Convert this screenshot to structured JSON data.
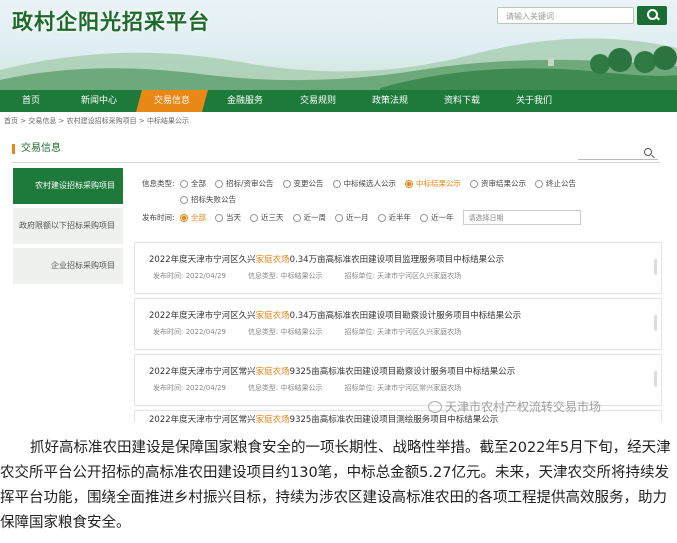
{
  "header": {
    "site_title": "政村企阳光招采平台",
    "search_placeholder": "请输入关键词"
  },
  "nav": [
    "首页",
    "新闻中心",
    "交易信息",
    "金融服务",
    "交易规则",
    "政策法规",
    "资料下载",
    "关于我们"
  ],
  "breadcrumb": "首页 > 交易信息 > 农村建设招标采购项目 > 中标结果公示",
  "panel": {
    "title": "交易信息",
    "sidebar": [
      "农村建设招标采购项目",
      "政府限额以下招标采购项目",
      "企业招标采购项目"
    ],
    "filters": {
      "info_type_label": "信息类型:",
      "info_types": [
        "全部",
        "招标/资审公告",
        "变更公告",
        "中标候选人公示",
        "中标结果公示",
        "资审结果公示",
        "终止公告",
        "招标失败公告"
      ],
      "time_label": "发布时间:",
      "times": [
        "全部",
        "当天",
        "近三天",
        "近一周",
        "近一月",
        "近半年",
        "近一年"
      ],
      "date_placeholder": "请选择日期"
    },
    "items": [
      {
        "title_pre": "2022年度天津市宁河区久兴",
        "title_hl": "家庭农场",
        "title_post": "0.34万亩高标准农田建设项目监理服务项目中标结果公示",
        "date": "发布时间:  2022/04/29",
        "type": "信息类型:  中标结果公示",
        "unit": "招标单位:  天津市宁河区久兴家庭农场"
      },
      {
        "title_pre": "2022年度天津市宁河区久兴",
        "title_hl": "家庭农场",
        "title_post": "0.34万亩高标准农田建设项目勘察设计服务项目中标结果公示",
        "date": "发布时间:  2022/04/29",
        "type": "信息类型:  中标结果公示",
        "unit": "招标单位:  天津市宁河区久兴家庭农场"
      },
      {
        "title_pre": "2022年度天津市宁河区常兴",
        "title_hl": "家庭农场",
        "title_post": "9325亩高标准农田建设项目勘察设计服务项目中标结果公示",
        "date": "发布时间:  2022/04/29",
        "type": "信息类型:  中标结果公示",
        "unit": "招标单位:  天津市宁河区常兴家庭农场"
      },
      {
        "title_pre": "2022年度天津市宁河区常兴",
        "title_hl": "家庭农场",
        "title_post": "9325亩高标准农田建设项目测绘服务项目中标结果公示",
        "date": "",
        "type": "",
        "unit": ""
      }
    ]
  },
  "watermark": "天津市农村产权流转交易市场",
  "article": [
    "抓好高标准农田建设是保障国家粮食安全的一项长期性、战略性举措。截至2022年5月下旬，经天津农交所平台公开招标的高标准农田建设项目约130笔，中标总金额5.27亿元。未来，天津农交所将持续发挥平台功能，围绕全面推进乡村振兴目标，持续为涉农区建设高标准农田的各项工程提供高效服务，助力保障国家粮食安全。"
  ]
}
